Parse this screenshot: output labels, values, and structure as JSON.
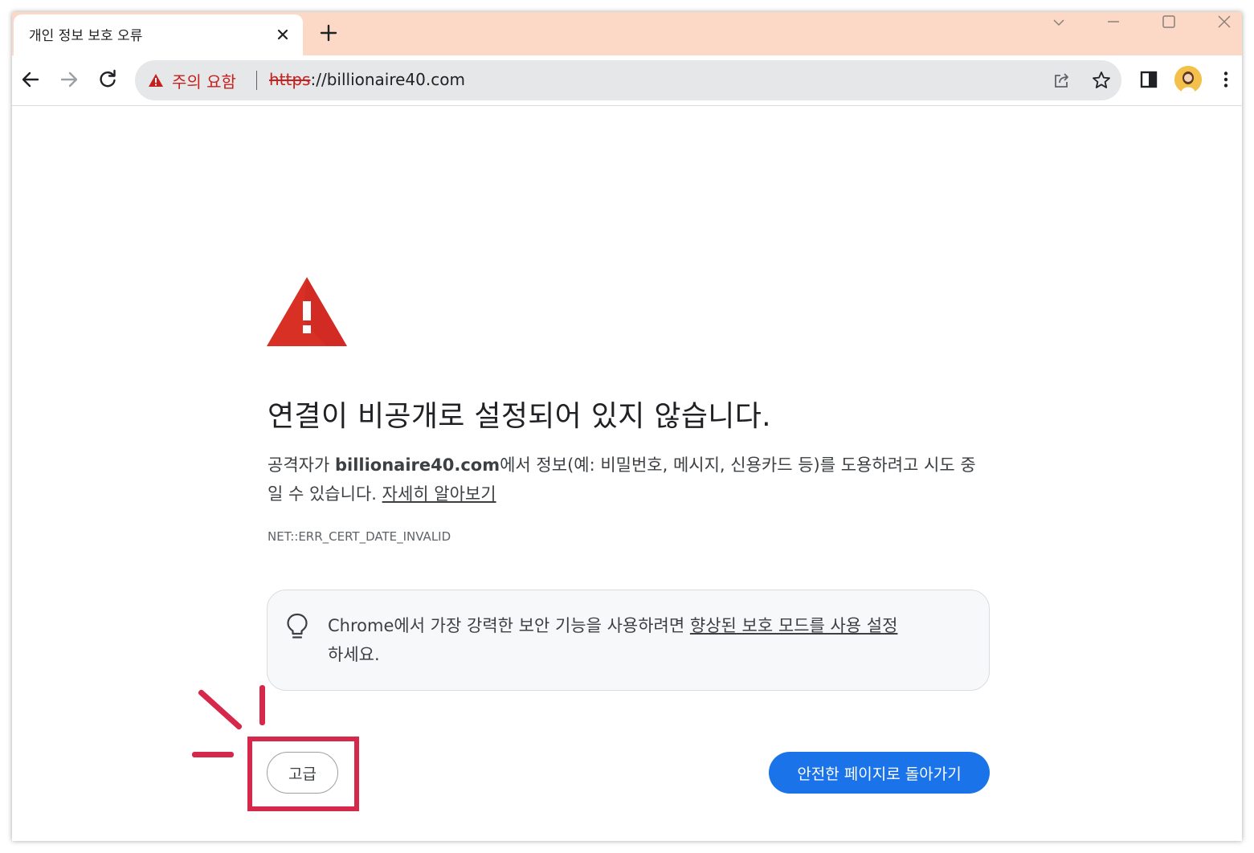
{
  "tab": {
    "title": "개인 정보 보호 오류"
  },
  "toolbar": {
    "security_warning": "주의 요함",
    "url_scheme": "https",
    "url_rest": "://billionaire40.com"
  },
  "page": {
    "headline": "연결이 비공개로 설정되어 있지 않습니다.",
    "desc_prefix": "공격자가 ",
    "desc_domain": "billionaire40.com",
    "desc_suffix": "에서 정보(예: 비밀번호, 메시지, 신용카드 등)를 도용하려고 시도 중일 수 있습니다. ",
    "learn_more": "자세히 알아보기",
    "error_code": "NET::ERR_CERT_DATE_INVALID",
    "hint_text": "Chrome에서 가장 강력한 보안 기능을 사용하려면 ",
    "hint_link": "향상된 보호 모드를 사용 설정",
    "hint_suffix": "하세요.",
    "advanced_button": "고급",
    "back_button": "안전한 페이지로 돌아가기"
  },
  "colors": {
    "accent_blue": "#1a73e8",
    "warning_red": "#c5221f",
    "annotation_red": "#d6284a",
    "titlebar_bg": "#fcd9c7"
  },
  "icons": [
    "close-icon",
    "new-tab-icon",
    "tab-search-icon",
    "minimize-icon",
    "maximize-icon",
    "window-close-icon",
    "back-icon",
    "forward-icon",
    "reload-icon",
    "warning-icon",
    "share-icon",
    "star-icon",
    "side-panel-icon",
    "avatar",
    "menu-icon",
    "warning-triangle-icon",
    "lightbulb-icon"
  ]
}
